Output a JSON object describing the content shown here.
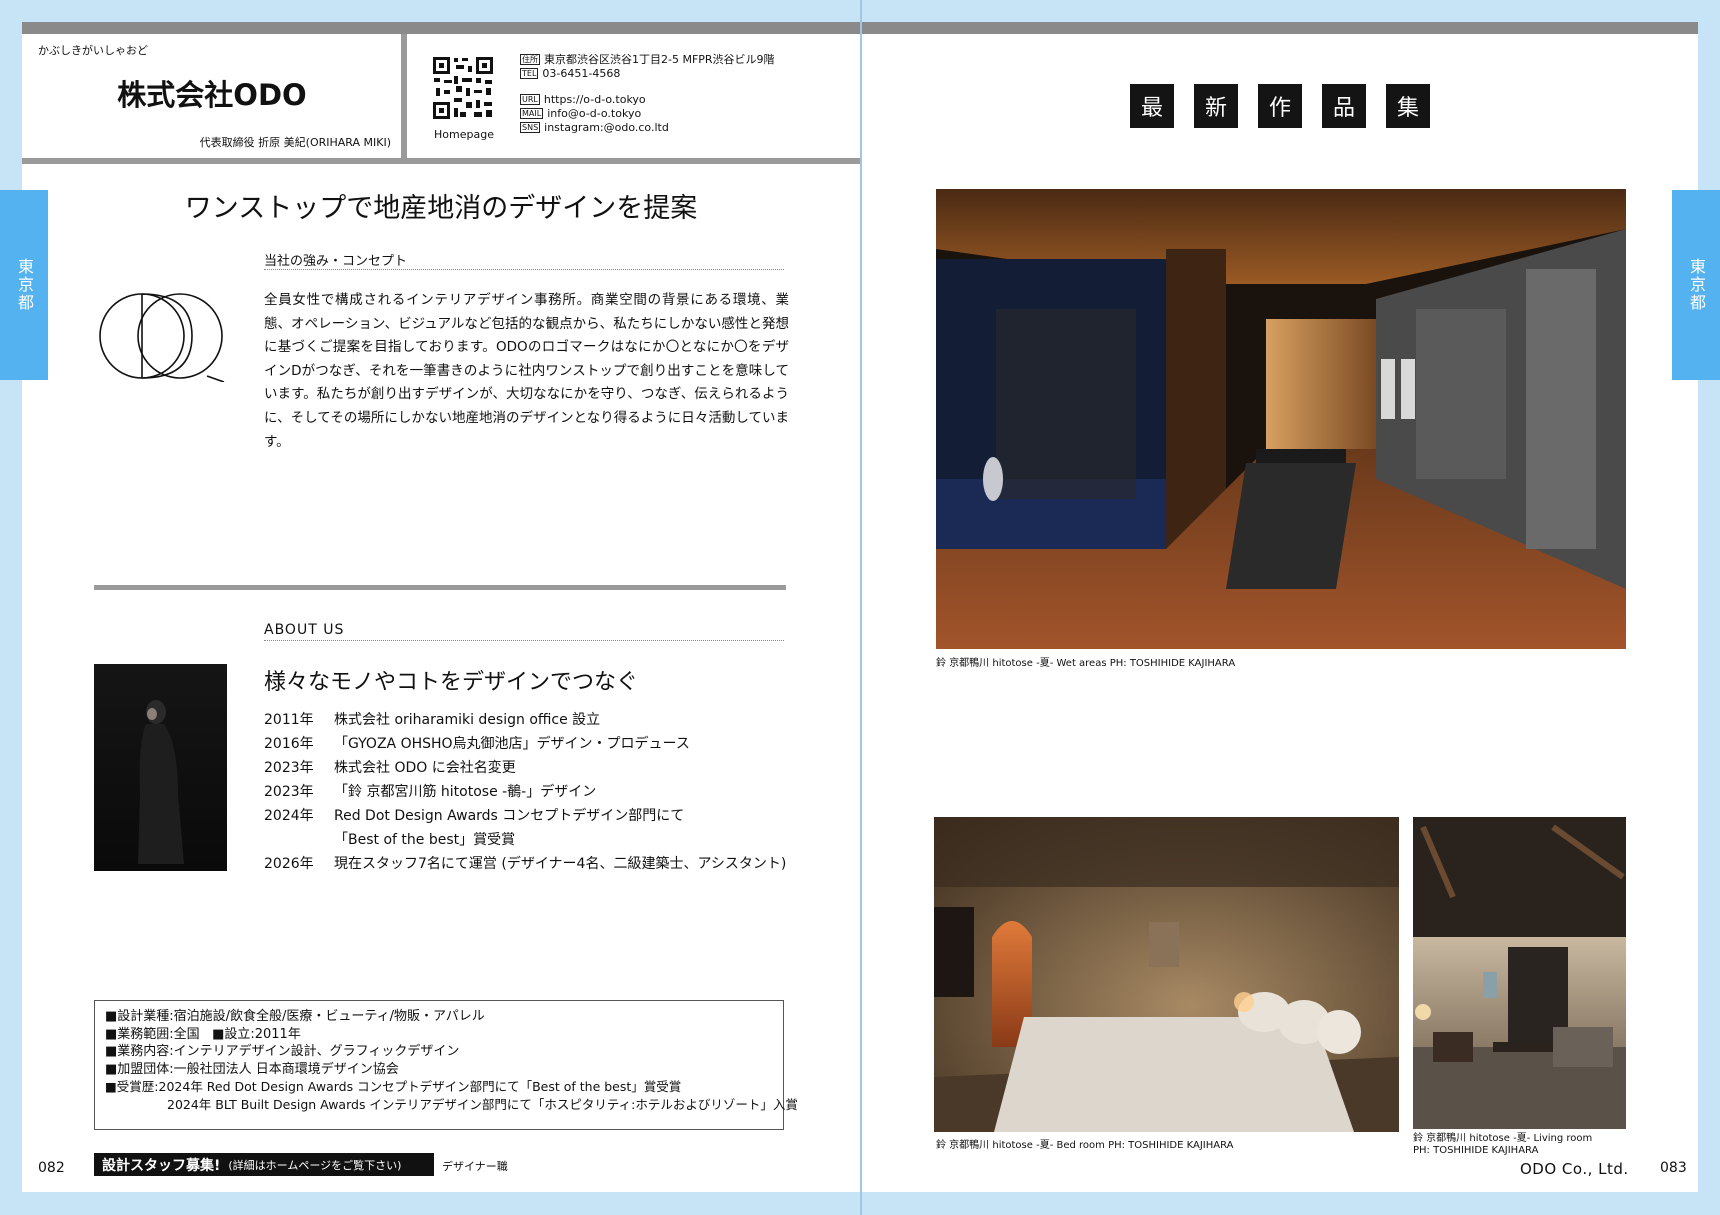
{
  "company": {
    "kana": "かぶしきがいしゃおど",
    "name": "株式会社ODO",
    "representative": "代表取締役 折原 美紀(ORIHARA MIKI)",
    "qr_label": "Homepage"
  },
  "contact": {
    "address_tag": "住所",
    "address": "東京都渋谷区渋谷1丁目2-5 MFPR渋谷ビル9階",
    "tel_tag": "TEL",
    "tel": "03-6451-4568",
    "url_tag": "URL",
    "url": "https://o-d-o.tokyo",
    "mail_tag": "MAIL",
    "mail": "info@o-d-o.tokyo",
    "sns_tag": "SNS",
    "sns": "instagram:@odo.co.ltd"
  },
  "side_tab": "東京都",
  "headline": "ワンストップで地産地消のデザインを提案",
  "concept": {
    "heading": "当社の強み・コンセプト",
    "body": "全員女性で構成されるインテリアデザイン事務所。商業空間の背景にある環境、業態、オペレーション、ビジュアルなど包括的な観点から、私たちにしかない感性と発想に基づくご提案を目指しております。ODOのロゴマークはなにか〇となにか〇をデザインDがつなぎ、それを一筆書きのように社内ワンストップで創り出すことを意味しています。私たちが創り出すデザインが、大切ななにかを守り、つなぎ、伝えられるように、そしてその場所にしかない地産地消のデザインとなり得るように日々活動しています。"
  },
  "about": {
    "heading": "ABOUT US",
    "title": "様々なモノやコトをデザインでつなぐ",
    "history": [
      {
        "year": "2011年",
        "text": "株式会社 oriharamiki design office 設立"
      },
      {
        "year": "2016年",
        "text": "「GYOZA OHSHO烏丸御池店」デザイン・プロデュース"
      },
      {
        "year": "2023年",
        "text": "株式会社 ODO に会社名変更"
      },
      {
        "year": "2023年",
        "text": "「鈴 京都宮川筋 hitotose -鶺-」デザイン"
      },
      {
        "year": "2024年",
        "text": "Red Dot Design Awards コンセプトデザイン部門にて"
      },
      {
        "year": "",
        "text": "「Best of the best」賞受賞"
      },
      {
        "year": "2026年",
        "text": "現在スタッフ7名にて運営 (デザイナー4名、二級建築士、アシスタント)"
      }
    ]
  },
  "info": {
    "line1": "■設計業種:宿泊施設/飲食全般/医療・ビューティ/物販・アパレル",
    "line2a": "■業務範囲:全国",
    "line2b": "■設立:2011年",
    "line3": "■業務内容:インテリアデザイン設計、グラフィックデザイン",
    "line4": "■加盟団体:一般社団法人 日本商環境デザイン協会",
    "line5": "■受賞歴:2024年 Red Dot Design Awards コンセプトデザイン部門にて「Best of the best」賞受賞",
    "line6": "2024年 BLT Built Design Awards インテリアデザイン部門にて「ホスピタリティ:ホテルおよびリゾート」入賞"
  },
  "recruit": {
    "title": "設計スタッフ募集!",
    "note": "(詳細はホームページをご覧下さい)",
    "position": "デザイナー職"
  },
  "page_numbers": {
    "left": "082",
    "right": "083"
  },
  "news_title": [
    "最",
    "新",
    "作",
    "品",
    "集"
  ],
  "captions": {
    "photo1": "鈴 京都鴨川 hitotose -夏-  Wet areas PH: TOSHIHIDE KAJIHARA",
    "photo2": "鈴 京都鴨川 hitotose -夏-  Bed room PH: TOSHIHIDE KAJIHARA",
    "photo3_line1": "鈴 京都鴨川 hitotose -夏-  Living room",
    "photo3_line2": "PH: TOSHIHIDE KAJIHARA"
  },
  "footer_company": "ODO Co., Ltd.",
  "colors": {
    "background": "#c7e4f7",
    "side_tab": "#53b2ef",
    "rule": "#9a9a9a",
    "news_box": "#141414"
  }
}
